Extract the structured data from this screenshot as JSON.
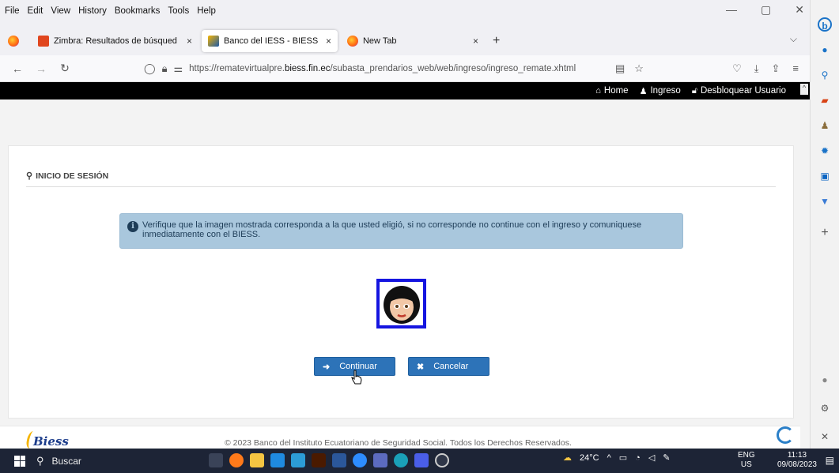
{
  "menu": [
    "File",
    "Edit",
    "View",
    "History",
    "Bookmarks",
    "Tools",
    "Help"
  ],
  "tabs": [
    {
      "label": "Zimbra: Resultados de búsqued",
      "close": "×"
    },
    {
      "label": "Banco del IESS - BIESS",
      "close": "×"
    },
    {
      "label": "New Tab",
      "close": "×"
    }
  ],
  "new_tab": "+",
  "url": {
    "prefix": "https://rematevirtualpre.",
    "domain": "biess.fin.ec",
    "path": "/subasta_prendarios_web/web/ingreso/ingreso_remate.xhtml"
  },
  "site_nav": {
    "home": "Home",
    "ingreso": "Ingreso",
    "desbloquear": "Desbloquear Usuario"
  },
  "card": {
    "title": "INICIO DE SESIÓN",
    "alert": "Verifique que la imagen mostrada corresponda a la que usted eligió, si no corresponde no continue con el ingreso y comuniquese inmediatamente con el BIESS."
  },
  "buttons": {
    "continuar": "Continuar",
    "cancelar": "Cancelar"
  },
  "footer": {
    "logo": "Biess",
    "copyright": "© 2023 Banco del Instituto Ecuatoriano de Seguridad Social. Todos los Derechos Reservados."
  },
  "taskbar": {
    "search": "Buscar",
    "temperature": "24°C",
    "lang_top": "ENG",
    "lang_bottom": "US",
    "time": "11:13",
    "date": "09/08/2023"
  },
  "colors": {
    "accent": "#2d73b8",
    "alert_bg": "#a9c7dd",
    "frame": "#1515e0"
  }
}
